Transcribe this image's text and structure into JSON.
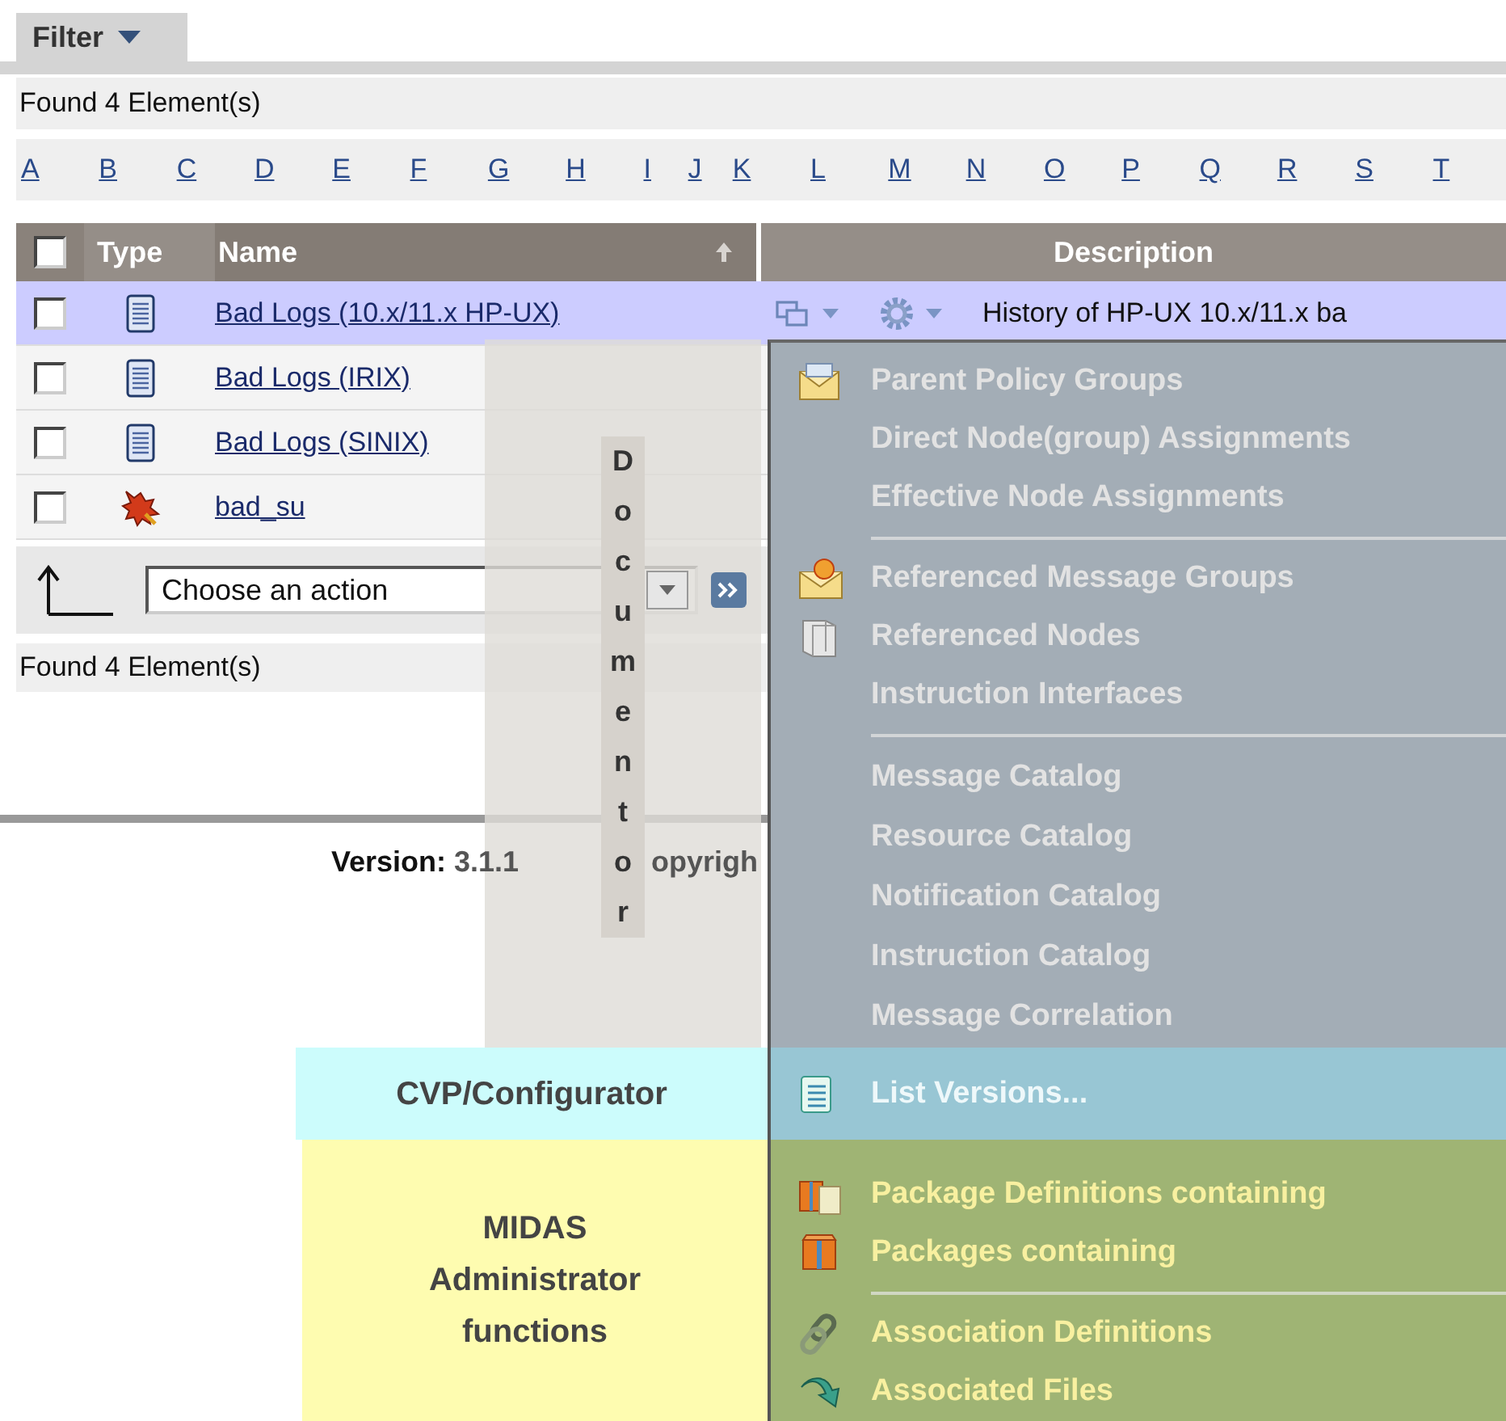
{
  "filter_tab": {
    "label": "Filter"
  },
  "found_top": "Found 4 Element(s)",
  "alphabet": [
    "A",
    "B",
    "C",
    "D",
    "E",
    "F",
    "G",
    "H",
    "I",
    "J",
    "K",
    "L",
    "M",
    "N",
    "O",
    "P",
    "Q",
    "R",
    "S",
    "T"
  ],
  "table": {
    "select_all_checked": false,
    "columns": [
      "Type",
      "Name",
      "Description"
    ],
    "rows": [
      {
        "kind": "document",
        "name": "Bad Logs (10.x/11.x HP-UX)",
        "checked": false,
        "selected": true,
        "description": "History of HP-UX 10.x/11.x ba"
      },
      {
        "kind": "document",
        "name": "Bad Logs (IRIX)",
        "checked": false,
        "selected": false
      },
      {
        "kind": "document",
        "name": "Bad Logs (SINIX)",
        "checked": false,
        "selected": false
      },
      {
        "kind": "bug",
        "name": "bad_su",
        "checked": false,
        "selected": false
      }
    ]
  },
  "action_select": {
    "value": "Choose an action"
  },
  "found_bottom": "Found 4 Element(s)",
  "footer": {
    "version": "**Version:** 3.1.1",
    "copyright": "opyrigh"
  },
  "sections": [
    {
      "kind": "documentor",
      "label": "Documentor",
      "groups": [
        [
          {
            "kind": "envelope",
            "label": "Parent Policy Groups"
          },
          {
            "kind": "plain",
            "label": "Direct Node(group) Assignments"
          },
          {
            "kind": "plain",
            "label": "Effective Node Assignments"
          }
        ],
        [
          {
            "kind": "burst",
            "label": "Referenced Message Groups"
          },
          {
            "kind": "server",
            "label": "Referenced Nodes"
          },
          {
            "kind": "plain",
            "label": "Instruction Interfaces"
          }
        ],
        [
          {
            "kind": "plain",
            "label": "Message Catalog"
          },
          {
            "kind": "plain",
            "label": "Resource Catalog"
          },
          {
            "kind": "plain",
            "label": "Notification Catalog"
          },
          {
            "kind": "plain",
            "label": "Instruction Catalog"
          },
          {
            "kind": "plain",
            "label": "Message Correlation"
          }
        ]
      ]
    },
    {
      "kind": "configurator",
      "label": "CVP/Configurator",
      "groups": [
        [
          {
            "kind": "document",
            "label": "List Versions..."
          }
        ]
      ]
    },
    {
      "kind": "administrator",
      "label": "MIDAS Administrator functions",
      "groups": [
        [
          {
            "kind": "packages",
            "label": "Package Definitions containing"
          },
          {
            "kind": "package",
            "label": "Packages containing"
          }
        ],
        [
          {
            "kind": "link",
            "label": "Association Definitions"
          },
          {
            "kind": "arrow",
            "label": "Associated Files"
          }
        ]
      ]
    }
  ]
}
